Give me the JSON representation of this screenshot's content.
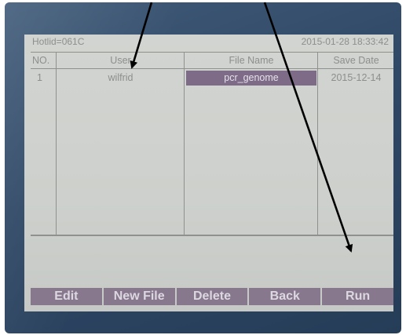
{
  "status": {
    "hotlid": "Hotlid=061C",
    "datetime": "2015-01-28 18:33:42"
  },
  "table": {
    "headers": [
      "NO.",
      "User",
      "File  Name",
      "Save Date"
    ],
    "rows": [
      {
        "no": "1",
        "user": "wilfrid",
        "file_name": "pcr_genome",
        "save_date": "2015-12-14"
      }
    ]
  },
  "softkeys": [
    "Edit",
    "New File",
    "Delete",
    "Back",
    "Run"
  ],
  "colors": {
    "screen": "#cfd1ce",
    "text": "#8c8f8c",
    "selected": "#7d6b88",
    "softkey": "#87788e",
    "bezel": "#34506f"
  }
}
